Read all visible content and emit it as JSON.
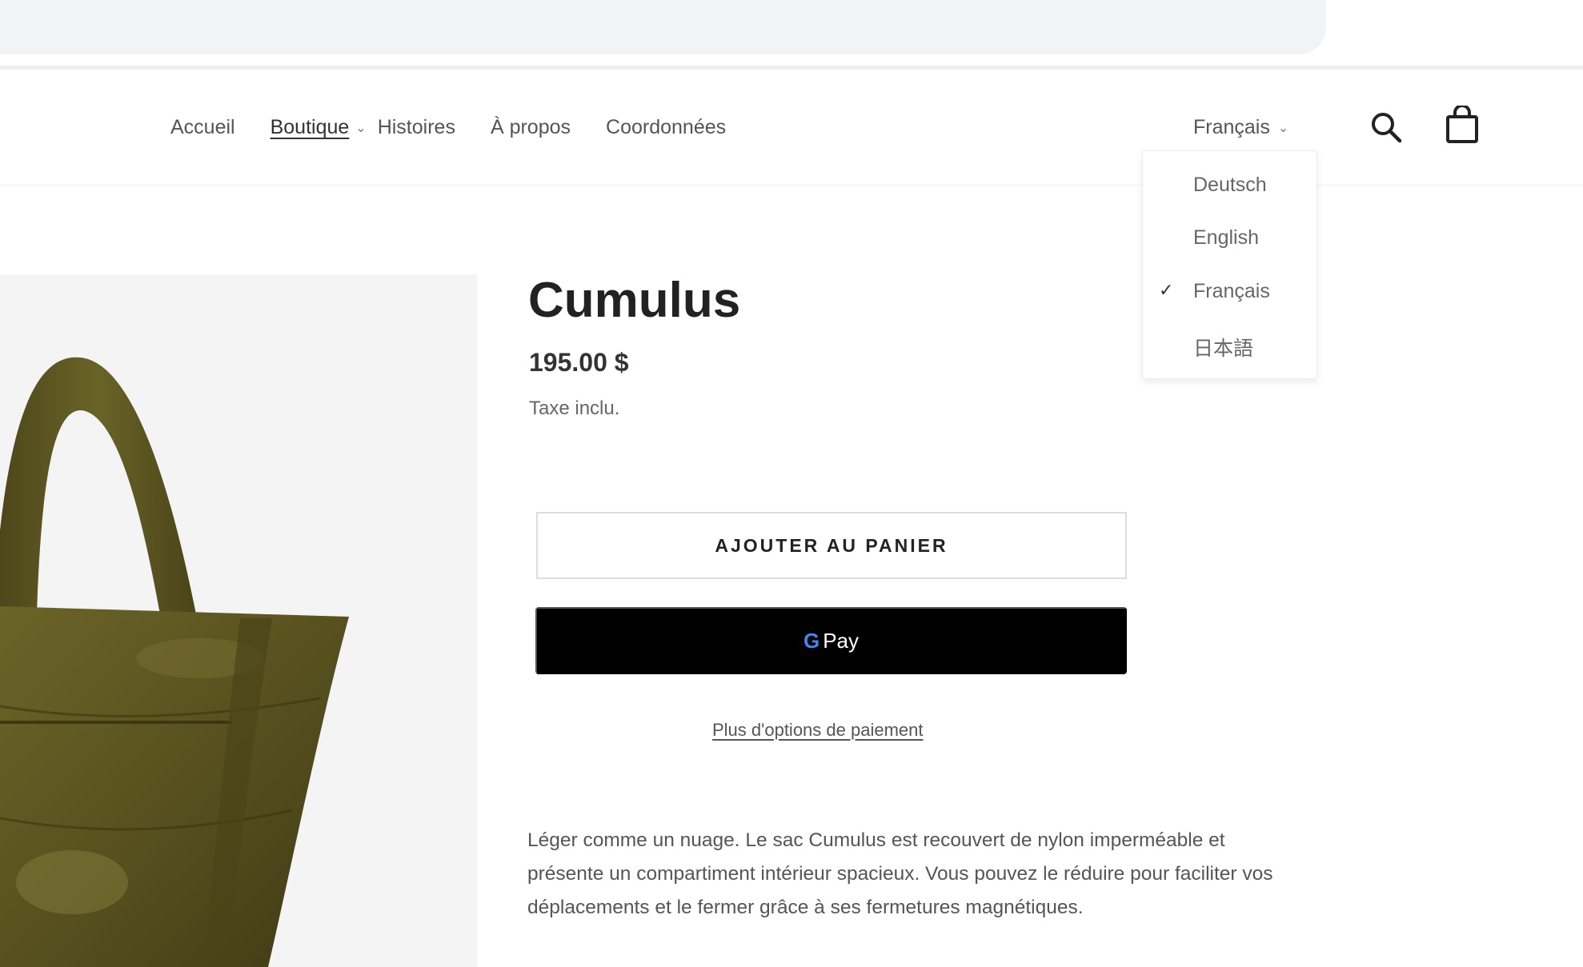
{
  "nav": {
    "items": [
      "Accueil",
      "Boutique",
      "Histoires",
      "À propos",
      "Coordonnées"
    ],
    "current_language": "Français"
  },
  "language_menu": {
    "options": [
      "Deutsch",
      "English",
      "Français",
      "日本語"
    ],
    "selected": "Français",
    "check_mark": "✓"
  },
  "product": {
    "title": "Cumulus",
    "price": "195.00 $",
    "tax_note": "Taxe inclu.",
    "add_to_cart_label": "AJOUTER AU PANIER",
    "gpay_g": "G",
    "gpay_label": "Pay",
    "more_payment_label": "Plus d'options de paiement",
    "description": "Léger comme un nuage. Le sac Cumulus est recouvert de nylon imperméable et présente un compartiment intérieur spacieux. Vous pouvez le réduire pour faciliter vos déplacements et le fermer grâce à ses fermetures magnétiques."
  },
  "icons": {
    "search": "search-icon",
    "cart": "shopping-bag-icon",
    "chevron": "chevron-down-icon"
  },
  "colors": {
    "bag_olive": "#5b5421",
    "button_black": "#000000",
    "background_gray": "#f4f4f4"
  }
}
